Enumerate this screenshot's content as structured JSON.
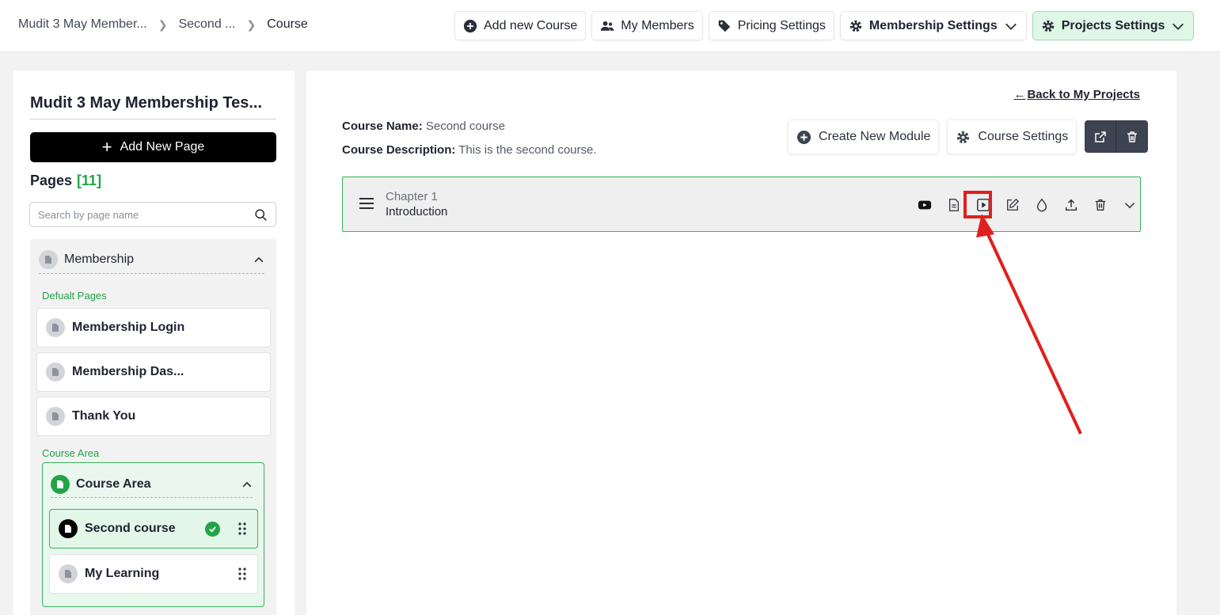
{
  "breadcrumb": {
    "items": [
      "Mudit 3 May Member...",
      "Second ...",
      "Course"
    ],
    "separator": ">"
  },
  "top_actions": {
    "add_course": "Add new Course",
    "members": "My Members",
    "pricing": "Pricing Settings",
    "membership_settings": "Membership Settings",
    "projects_settings": "Projects Settings"
  },
  "sidebar": {
    "title": "Mudit 3 May Membership Tes...",
    "add_page": "Add New Page",
    "pages_label": "Pages",
    "pages_count": "[11]",
    "search_placeholder": "Search by page name",
    "group": {
      "label": "Membership",
      "default_pages_label": "Defualt Pages",
      "default_pages": [
        "Membership Login",
        "Membership Das...",
        "Thank You"
      ],
      "course_area_label": "Course Area",
      "course_area": {
        "label": "Course Area",
        "items": [
          "Second course",
          "My Learning"
        ]
      }
    }
  },
  "main": {
    "back_link": "Back to My Projects",
    "course_name_label": "Course Name:",
    "course_name": "Second course",
    "course_desc_label": "Course Description:",
    "course_desc": "This is the second course.",
    "create_module": "Create New Module",
    "course_settings": "Course Settings",
    "chapter": {
      "subtitle": "Chapter 1",
      "title": "Introduction"
    }
  },
  "colors": {
    "accent_green": "#22a447",
    "highlight_red": "#e0201d",
    "dark_button": "#3d4350"
  }
}
